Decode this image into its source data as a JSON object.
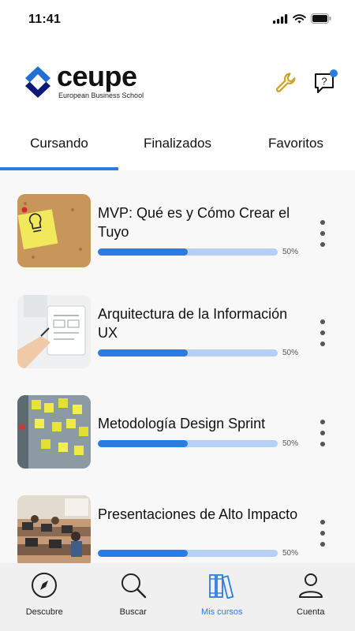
{
  "status_bar": {
    "time": "11:41"
  },
  "header": {
    "brand_name": "ceupe",
    "brand_subtitle": "European Business School",
    "settings_icon": "wrench-icon",
    "help_icon": "help-chat-icon",
    "notification_dot_color": "#2a7be4",
    "accent_color": "#2a7be4",
    "wrench_color": "#c9a227"
  },
  "tabs": [
    {
      "label": "Cursando",
      "active": true
    },
    {
      "label": "Finalizados",
      "active": false
    },
    {
      "label": "Favoritos",
      "active": false
    }
  ],
  "courses": [
    {
      "title": "MVP: Qué es y Cómo Crear el Tuyo",
      "progress": 0.5,
      "progress_label": "50%",
      "thumbnail": "sticky-note-lightbulb-image"
    },
    {
      "title": "Arquitectura de la Información UX",
      "progress": 0.5,
      "progress_label": "50%",
      "thumbnail": "wireframe-notebook-image"
    },
    {
      "title": "Metodología Design Sprint",
      "progress": 0.5,
      "progress_label": "50%",
      "thumbnail": "sticky-notes-wall-image"
    },
    {
      "title": "Presentaciones de Alto Impacto",
      "progress": 0.5,
      "progress_label": "50%",
      "thumbnail": "classroom-image"
    }
  ],
  "bottom_nav": [
    {
      "label": "Descubre",
      "icon": "compass-icon",
      "active": false
    },
    {
      "label": "Buscar",
      "icon": "search-icon",
      "active": false
    },
    {
      "label": "Mis cursos",
      "icon": "books-icon",
      "active": true
    },
    {
      "label": "Cuenta",
      "icon": "user-icon",
      "active": false
    }
  ]
}
